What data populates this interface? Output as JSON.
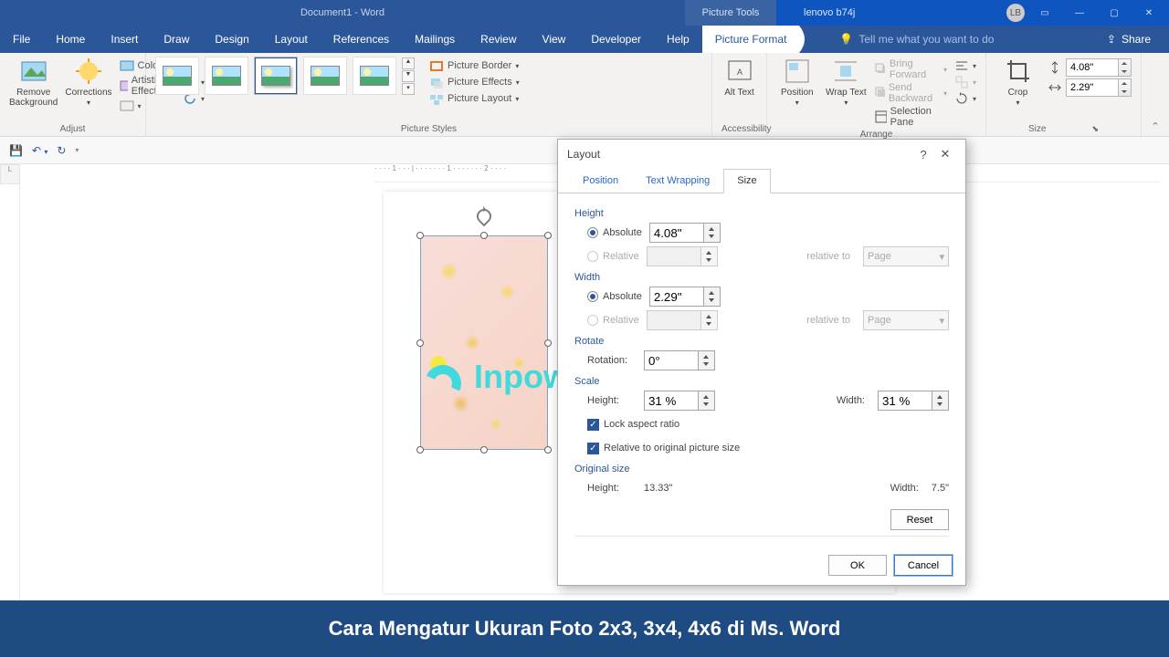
{
  "titlebar": {
    "doc_title": "Document1 - Word",
    "tool_tab": "Picture Tools",
    "user": "lenovo b74j",
    "avatar_initials": "LB"
  },
  "menu": {
    "items": [
      "File",
      "Home",
      "Insert",
      "Draw",
      "Design",
      "Layout",
      "References",
      "Mailings",
      "Review",
      "View",
      "Developer",
      "Help",
      "Picture Format"
    ],
    "active": "Picture Format",
    "tellme": "Tell me what you want to do",
    "share": "Share"
  },
  "ribbon": {
    "remove_bg": "Remove Background",
    "corrections": "Corrections",
    "color": "Color",
    "artistic": "Artistic Effects",
    "adjust_label": "Adjust",
    "picture_styles_label": "Picture Styles",
    "border": "Picture Border",
    "effects": "Picture Effects",
    "layout": "Picture Layout",
    "alt_text": "Alt Text",
    "accessibility_label": "Accessibility",
    "position": "Position",
    "wrap": "Wrap Text",
    "bring_fwd": "Bring Forward",
    "send_back": "Send Backward",
    "selection_pane": "Selection Pane",
    "arrange_label": "Arrange",
    "crop": "Crop",
    "height": "4.08\"",
    "width": "2.29\"",
    "size_label": "Size"
  },
  "dialog": {
    "title": "Layout",
    "tabs": {
      "position": "Position",
      "wrapping": "Text Wrapping",
      "size": "Size"
    },
    "height_section": "Height",
    "width_section": "Width",
    "absolute": "Absolute",
    "relative": "Relative",
    "relative_to": "relative to",
    "relative_opt": "Page",
    "height_abs": "4.08\"",
    "width_abs": "2.29\"",
    "rotate_section": "Rotate",
    "rotation_label": "Rotation:",
    "rotation_val": "0°",
    "scale_section": "Scale",
    "scale_height_label": "Height:",
    "scale_width_label": "Width:",
    "scale_height": "31 %",
    "scale_width": "31 %",
    "lock_aspect": "Lock aspect ratio",
    "relative_original": "Relative to original picture size",
    "original_section": "Original size",
    "orig_height_label": "Height:",
    "orig_width_label": "Width:",
    "orig_height": "13.33\"",
    "orig_width": "7.5\"",
    "reset": "Reset",
    "ok": "OK",
    "cancel": "Cancel"
  },
  "watermark": "Inpowin",
  "caption": "Cara Mengatur Ukuran Foto 2x3, 3x4, 4x6 di Ms. Word"
}
